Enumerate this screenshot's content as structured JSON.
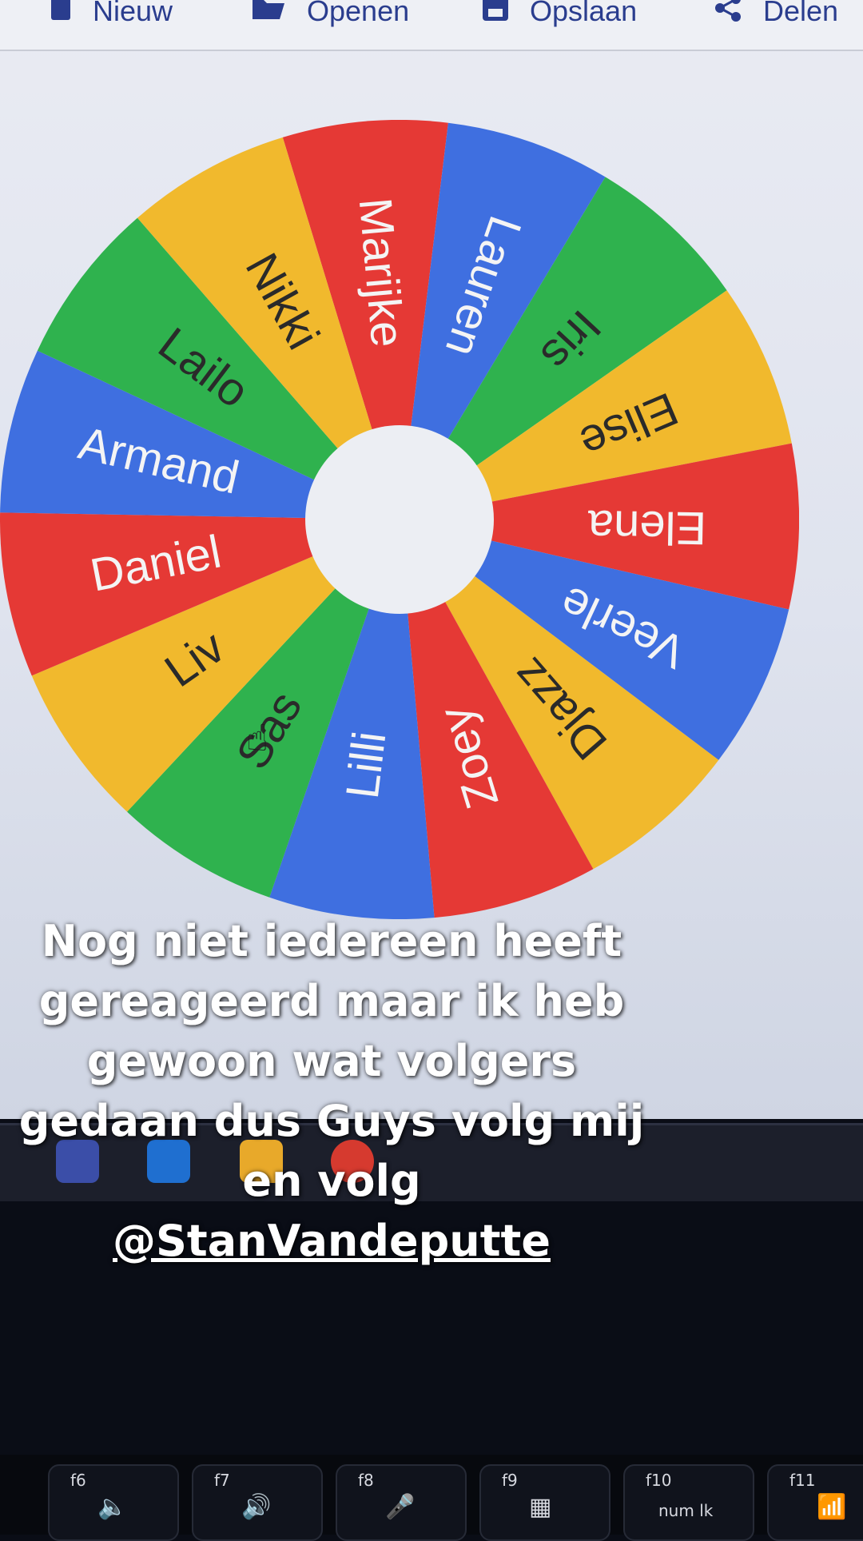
{
  "toolbar": {
    "items": [
      {
        "label": "Nieuw",
        "icon": "file-icon"
      },
      {
        "label": "Openen",
        "icon": "folder-icon"
      },
      {
        "label": "Opslaan",
        "icon": "save-icon"
      },
      {
        "label": "Delen",
        "icon": "share-icon"
      }
    ]
  },
  "wheel": {
    "segments": [
      {
        "name": "Marijke",
        "color": "#e53935"
      },
      {
        "name": "Lauren",
        "color": "#3f6fe0"
      },
      {
        "name": "Iris",
        "color": "#2fb24e"
      },
      {
        "name": "Elise",
        "color": "#f1b92d"
      },
      {
        "name": "Elena",
        "color": "#e53935"
      },
      {
        "name": "Veerle",
        "color": "#3f6fe0"
      },
      {
        "name": "Djazz",
        "color": "#f1b92d"
      },
      {
        "name": "Zoey",
        "color": "#e53935"
      },
      {
        "name": "Lilli",
        "color": "#3f6fe0"
      },
      {
        "name": "Sas",
        "color": "#2fb24e"
      },
      {
        "name": "Liv",
        "color": "#f1b92d"
      },
      {
        "name": "Daniel",
        "color": "#e53935"
      },
      {
        "name": "Armand",
        "color": "#3f6fe0"
      },
      {
        "name": "Lailo",
        "color": "#2fb24e"
      },
      {
        "name": "Nikki",
        "color": "#f1b92d"
      }
    ],
    "center_icon": "hand-pointer-icon"
  },
  "taskbar": {
    "icons": [
      "windows-icon",
      "outlook-icon",
      "file-explorer-icon",
      "chrome-icon"
    ]
  },
  "keyboard": {
    "keys": [
      {
        "fn": "f6",
        "symbol": "🔈"
      },
      {
        "fn": "f7",
        "symbol": "🔊"
      },
      {
        "fn": "f8",
        "symbol": "🎤"
      },
      {
        "fn": "f9",
        "symbol": "▦"
      },
      {
        "fn": "f10",
        "symbol": "num lk"
      },
      {
        "fn": "f11",
        "symbol": "📶"
      }
    ]
  },
  "caption": {
    "text": "Nog niet iedereen heeft gereageerd maar ik heb gewoon wat volgers gedaan dus Guys volg mij en volg",
    "mention": "@StanVandeputte"
  }
}
